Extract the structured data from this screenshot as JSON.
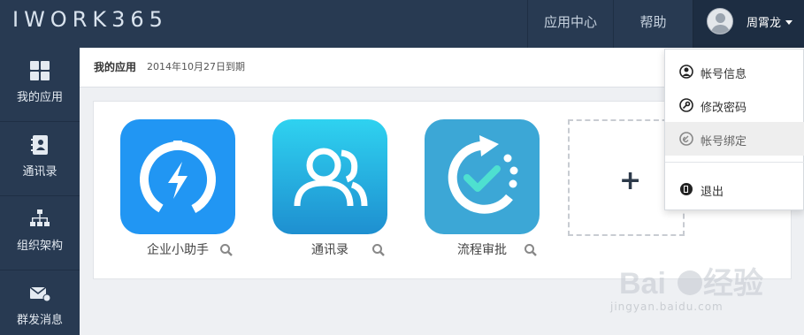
{
  "brand": {
    "logo_text": "IWORK365"
  },
  "topbar": {
    "nav_app_center": "应用中心",
    "nav_help": "帮助",
    "user_name": "周霄龙"
  },
  "sidebar": {
    "items": [
      {
        "label": "我的应用",
        "icon": "grid-icon"
      },
      {
        "label": "通讯录",
        "icon": "contacts-book-icon"
      },
      {
        "label": "组织架构",
        "icon": "org-chart-icon"
      },
      {
        "label": "群发消息",
        "icon": "mail-broadcast-icon"
      }
    ]
  },
  "breadcrumb": {
    "title": "我的应用",
    "expire": "2014年10月27日到期"
  },
  "apps": [
    {
      "name": "企业小助手",
      "icon": "lightning-assistant-icon",
      "color": "#2196f3"
    },
    {
      "name": "通讯录",
      "icon": "users-icon",
      "color": "#1ea7e0"
    },
    {
      "name": "流程审批",
      "icon": "approval-check-icon",
      "color": "#3ca7d6"
    }
  ],
  "add_tile": {
    "symbol": "+"
  },
  "dropdown": {
    "items": [
      {
        "label": "帐号信息",
        "icon": "user-circle-icon"
      },
      {
        "label": "修改密码",
        "icon": "key-icon"
      },
      {
        "label": "帐号绑定",
        "icon": "link-icon"
      },
      {
        "label": "退出",
        "icon": "exit-icon"
      }
    ]
  },
  "watermark": {
    "brand": "Bai du 经验",
    "url": "jingyan.baidu.com"
  },
  "colors": {
    "topbar_bg": "#283a52",
    "sidebar_bg": "#283a52",
    "content_bg": "#eef0f3"
  }
}
